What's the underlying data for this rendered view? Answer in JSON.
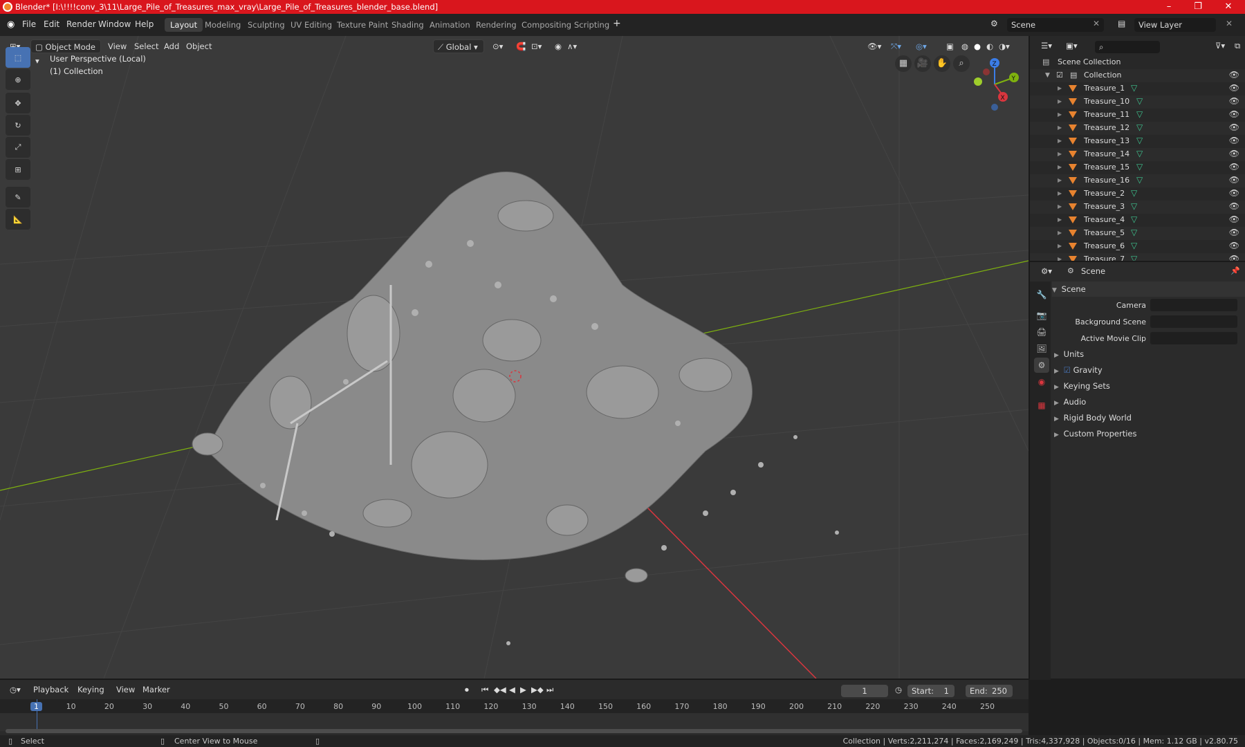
{
  "window": {
    "title": "Blender* [I:\\!!!!conv_3\\11\\Large_Pile_of_Treasures_max_vray\\Large_Pile_of_Treasures_blender_base.blend]",
    "minimize": "–",
    "maximize": "❐",
    "close": "✕"
  },
  "menu": {
    "file": "File",
    "edit": "Edit",
    "render": "Render",
    "window": "Window",
    "help": "Help"
  },
  "workspaces": [
    "Layout",
    "Modeling",
    "Sculpting",
    "UV Editing",
    "Texture Paint",
    "Shading",
    "Animation",
    "Rendering",
    "Compositing",
    "Scripting"
  ],
  "active_workspace": "Layout",
  "scene_field": "Scene",
  "view_layer_field": "View Layer",
  "viewport": {
    "mode": "Object Mode",
    "menus": {
      "view": "View",
      "select": "Select",
      "add": "Add",
      "object": "Object"
    },
    "orientation": "Global",
    "perspective_label": "User Perspective (Local)",
    "collection_label": "(1) Collection",
    "gizmo": {
      "x": "X",
      "y": "Y",
      "z": "Z"
    }
  },
  "outliner": {
    "root": "Scene Collection",
    "collection": "Collection",
    "items": [
      "Treasure_1",
      "Treasure_10",
      "Treasure_11",
      "Treasure_12",
      "Treasure_13",
      "Treasure_14",
      "Treasure_15",
      "Treasure_16",
      "Treasure_2",
      "Treasure_3",
      "Treasure_4",
      "Treasure_5",
      "Treasure_6",
      "Treasure_7"
    ]
  },
  "properties": {
    "context": "Scene",
    "panel": "Scene",
    "camera_label": "Camera",
    "background_scene_label": "Background Scene",
    "active_movie_clip_label": "Active Movie Clip",
    "sections": {
      "units": "Units",
      "gravity": "Gravity",
      "keying_sets": "Keying Sets",
      "audio": "Audio",
      "rigid_body_world": "Rigid Body World",
      "custom_properties": "Custom Properties"
    }
  },
  "timeline": {
    "menus": {
      "playback": "Playback",
      "keying": "Keying",
      "view": "View",
      "marker": "Marker"
    },
    "current_frame": "1",
    "start_label": "Start:",
    "start": "1",
    "end_label": "End:",
    "end": "250",
    "ticks": [
      "1",
      "10",
      "20",
      "30",
      "40",
      "50",
      "60",
      "70",
      "80",
      "90",
      "100",
      "110",
      "120",
      "130",
      "140",
      "150",
      "160",
      "170",
      "180",
      "190",
      "200",
      "210",
      "220",
      "230",
      "240",
      "250"
    ]
  },
  "status": {
    "select": "Select",
    "center_view": "Center View to Mouse",
    "stats": "Collection | Verts:2,211,274 | Faces:2,169,249 | Tris:4,337,928 | Objects:0/16 | Mem: 1.12 GB | v2.80.75"
  },
  "colors": {
    "titlebar": "#d9161d",
    "active_tool": "#4772b3",
    "x_axis": "#d9363e",
    "y_axis": "#7fb20f",
    "z_axis": "#3b7de8",
    "object": "#e8832f",
    "mesh": "#3ec48f"
  }
}
